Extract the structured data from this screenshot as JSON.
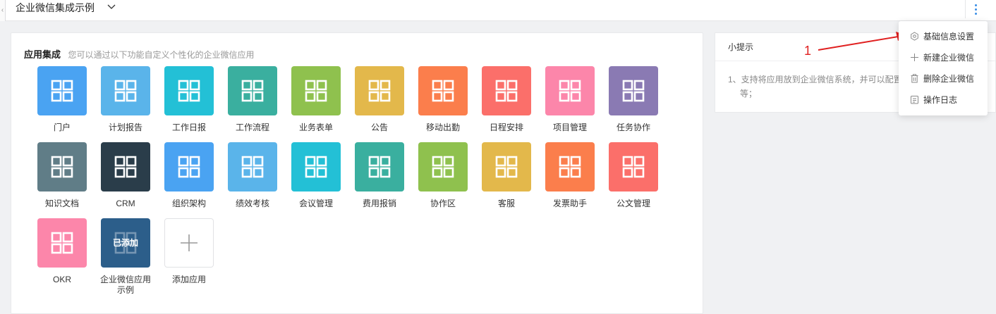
{
  "header": {
    "app_name": "企业微信集成示例",
    "collapse_glyph": "‹"
  },
  "section": {
    "title": "应用集成",
    "subtitle": "您可以通过以下功能自定义个性化的企业微信应用"
  },
  "apps": [
    {
      "label": "门户",
      "color": "#4aa3f2"
    },
    {
      "label": "计划报告",
      "color": "#5ab4ea"
    },
    {
      "label": "工作日报",
      "color": "#23c0d6"
    },
    {
      "label": "工作流程",
      "color": "#3aaf9f"
    },
    {
      "label": "业务表单",
      "color": "#8fc14e"
    },
    {
      "label": "公告",
      "color": "#e3b84b"
    },
    {
      "label": "移动出勤",
      "color": "#fb7e4c"
    },
    {
      "label": "日程安排",
      "color": "#fb6f6a"
    },
    {
      "label": "项目管理",
      "color": "#fc86aa"
    },
    {
      "label": "任务协作",
      "color": "#8a7ab3"
    },
    {
      "label": "知识文档",
      "color": "#607d87"
    },
    {
      "label": "CRM",
      "color": "#2a3d4a"
    },
    {
      "label": "组织架构",
      "color": "#4aa3f2"
    },
    {
      "label": "绩效考核",
      "color": "#5ab4ea"
    },
    {
      "label": "会议管理",
      "color": "#23c0d6"
    },
    {
      "label": "费用报销",
      "color": "#3aaf9f"
    },
    {
      "label": "协作区",
      "color": "#8fc14e"
    },
    {
      "label": "客服",
      "color": "#e3b84b"
    },
    {
      "label": "发票助手",
      "color": "#fb7e4c"
    },
    {
      "label": "公文管理",
      "color": "#fb6f6a"
    },
    {
      "label": "OKR",
      "color": "#fc86aa"
    },
    {
      "label": "企业微信应用示例",
      "color": "#2c5e8a",
      "badge": "已添加"
    }
  ],
  "add_app": {
    "label": "添加应用",
    "icon": "plus-icon"
  },
  "tips": {
    "title": "小提示",
    "line1": "1、支持将应用放到企业微信系统，并可以配置",
    "line2": "等；"
  },
  "menu": {
    "items": [
      {
        "label": "基础信息设置",
        "icon": "settings-icon"
      },
      {
        "label": "新建企业微信",
        "icon": "plus-icon"
      },
      {
        "label": "删除企业微信",
        "icon": "trash-icon"
      },
      {
        "label": "操作日志",
        "icon": "log-icon"
      }
    ]
  },
  "annotation": {
    "number": "1",
    "color": "#e02020"
  },
  "colors": {
    "accent": "#3a8ee6",
    "icon_glyph": "#ffffff"
  }
}
